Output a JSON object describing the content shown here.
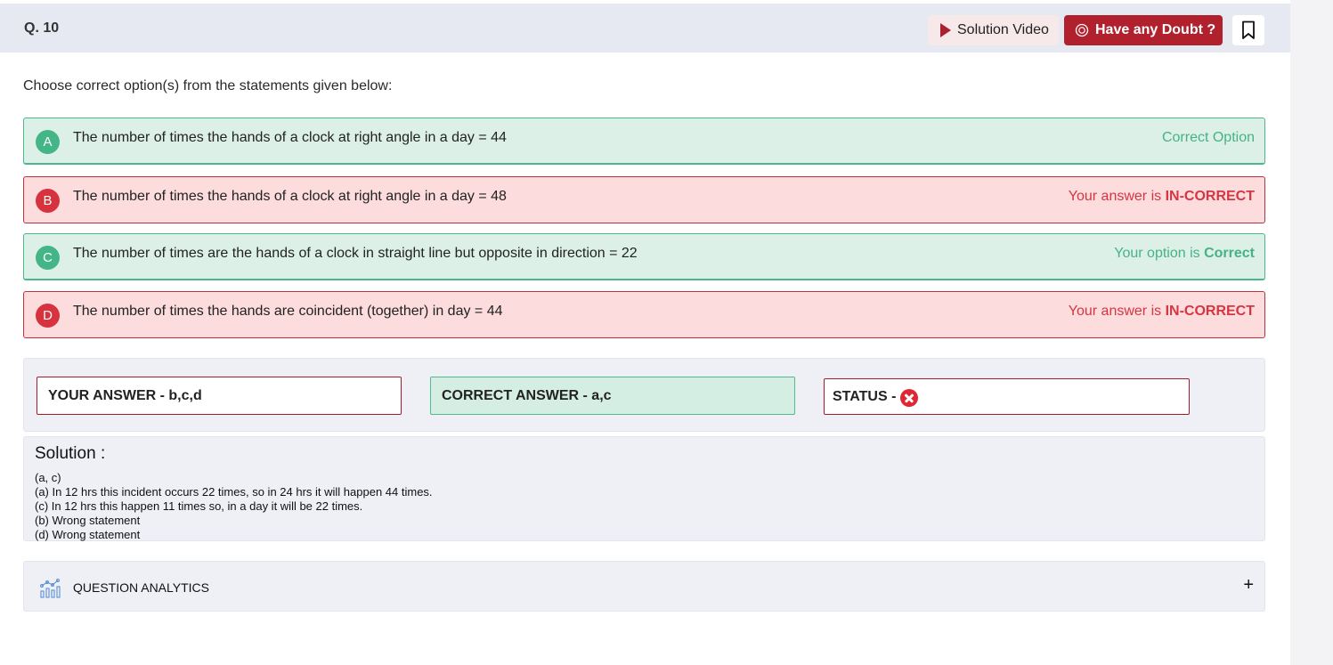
{
  "question": {
    "number": "Q. 10",
    "prompt": "Choose correct option(s) from the statements given below:"
  },
  "toolbar": {
    "video_label": "Solution Video",
    "doubt_label": "Have any Doubt ?"
  },
  "options": [
    {
      "letter": "A",
      "text": "The number of times the hands of a clock at right angle in a day = 44",
      "status_prefix": "Correct Option",
      "status_strong": ""
    },
    {
      "letter": "B",
      "text": "The number of times the hands of a clock at right angle in a day = 48",
      "status_prefix": "Your answer is ",
      "status_strong": "IN-CORRECT"
    },
    {
      "letter": "C",
      "text": "The number of times are the hands of a clock in straight line but opposite in direction = 22",
      "status_prefix": "Your option is ",
      "status_strong": "Correct"
    },
    {
      "letter": "D",
      "text": "The number of times the hands are coincident (together) in day = 44",
      "status_prefix": "Your answer is ",
      "status_strong": "IN-CORRECT"
    }
  ],
  "answers": {
    "your": "YOUR ANSWER - b,c,d",
    "correct": "CORRECT ANSWER - a,c",
    "status_label": "STATUS -"
  },
  "solution": {
    "title": "Solution :",
    "lines": [
      "(a, c)",
      "(a) In 12 hrs this incident occurs 22 times, so in 24 hrs it will happen 44 times.",
      "(c) In 12 hrs this happen 11 times so, in a day it will be 22 times.",
      "(b) Wrong statement",
      "(d) Wrong statement"
    ]
  },
  "analytics": {
    "label": "QUESTION ANALYTICS",
    "toggle": "+"
  },
  "colors": {
    "correct_green": "#43b587",
    "incorrect_red": "#d6333f",
    "brand_red": "#b0212d"
  }
}
